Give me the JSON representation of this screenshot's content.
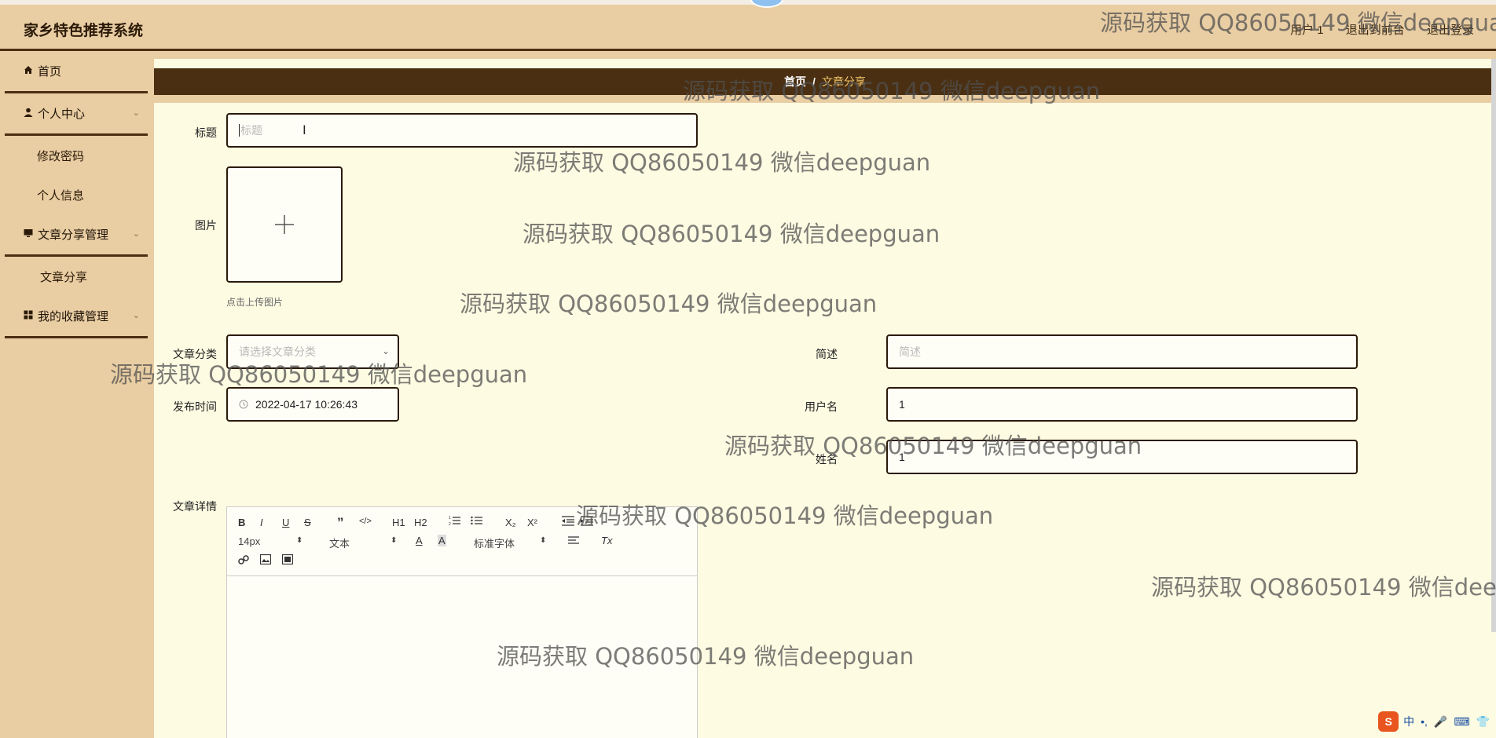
{
  "header": {
    "app_title": "家乡特色推荐系统",
    "user_label": "用户 1",
    "back_to_front": "退出到前台",
    "logout": "退出登录"
  },
  "sidebar": {
    "home": "首页",
    "personal_center": "个人中心",
    "change_password": "修改密码",
    "personal_info": "个人信息",
    "article_mgmt": "文章分享管理",
    "article_share": "文章分享",
    "favorites_mgmt": "我的收藏管理"
  },
  "breadcrumb": {
    "home": "首页",
    "separator": "/",
    "current": "文章分享"
  },
  "form": {
    "title_label": "标题",
    "title_placeholder": "标题",
    "image_label": "图片",
    "upload_hint": "点击上传图片",
    "category_label": "文章分类",
    "category_placeholder": "请选择文章分类",
    "summary_label": "简述",
    "summary_placeholder": "简述",
    "publish_time_label": "发布时间",
    "publish_time_value": "2022-04-17 10:26:43",
    "username_label": "用户名",
    "username_value": "1",
    "name_label": "姓名",
    "name_value": "1",
    "detail_label": "文章详情"
  },
  "editor": {
    "font_size": "14px",
    "block_type": "文本",
    "font_family": "标准字体",
    "buttons": {
      "bold": "B",
      "italic": "I",
      "underline": "U",
      "strike": "S",
      "quote": "”",
      "code": "</>",
      "h1": "H1",
      "h2": "H2",
      "sub": "X₂",
      "sup": "X²",
      "color": "A",
      "bg": "A",
      "clear": "Tx"
    }
  },
  "watermark": {
    "text": "源码获取 QQ86050149 微信deepguan",
    "text_cut_top": "源码获取 QQ86050149 微信deepgua",
    "text_cut_right": "源码获取 QQ86050149 微信dee"
  },
  "ime": {
    "logo": "S",
    "mode": "中",
    "punct": "•,"
  }
}
